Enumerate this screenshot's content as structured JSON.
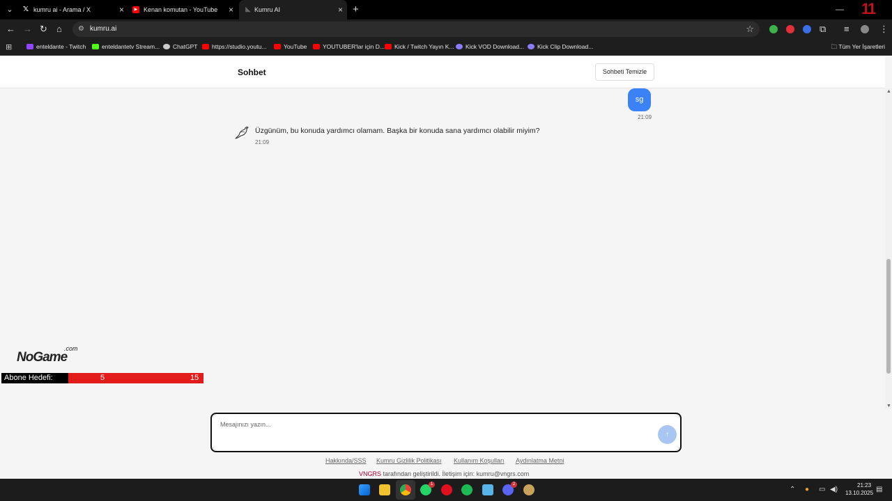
{
  "browser": {
    "tabs": [
      {
        "title": "kumru ai - Arama / X",
        "icon": "x-logo-icon"
      },
      {
        "title": "Kenan komutan - YouTube",
        "icon": "youtube-icon"
      },
      {
        "title": "Kumru AI",
        "icon": "kumru-icon"
      }
    ],
    "url": "kumru.ai",
    "bookmarks": [
      {
        "label": "enteldante - Twitch",
        "color": "#9146ff"
      },
      {
        "label": "enteldantetv Stream...",
        "color": "#53fc18"
      },
      {
        "label": "ChatGPT",
        "color": "#cccccc"
      },
      {
        "label": "https://studio.youtu...",
        "color": "#ff0000"
      },
      {
        "label": "YouTube",
        "color": "#ff0000"
      },
      {
        "label": "YOUTUBER'lar için D...",
        "color": "#ff0000"
      },
      {
        "label": "Kick / Twitch Yayın K...",
        "color": "#ff0000"
      },
      {
        "label": "Kick VOD Download...",
        "color": "#8a7cff"
      },
      {
        "label": "Kick Clip Download...",
        "color": "#8a7cff"
      }
    ],
    "all_bookmarks": "Tüm Yer İşaretleri"
  },
  "page": {
    "title": "Sohbet",
    "clear_button": "Sohbeti Temizle"
  },
  "chat": {
    "user_message": "sg",
    "user_time": "21:09",
    "bot_message": "Üzgünüm, bu konuda yardımcı olamam. Başka bir konuda sana yardımcı olabilir miyim?",
    "bot_time": "21:09"
  },
  "overlay": {
    "logo_text": "NoGame",
    "logo_suffix": ".com",
    "goal_label": "Abone Hedefi:",
    "goal_current": "5",
    "goal_target": "15"
  },
  "composer": {
    "placeholder": "Mesajınızı yazın...",
    "send_icon": "↑"
  },
  "footer": {
    "links": [
      "Hakkında/SSS",
      "Kumru Gizlilik Politikası",
      "Kullanım Koşulları",
      "Aydınlatma Metni"
    ],
    "credit_brand": "VNGRS",
    "credit_text": " tarafından geliştirildi. İletişim için: kumru@vngrs.com"
  },
  "taskbar": {
    "time": "21:23",
    "date": "13.10.2025",
    "badges": {
      "whatsapp": "1",
      "discord": "2"
    }
  },
  "colors": {
    "accent": "#3b82f6",
    "send_disabled": "#a9c6f3",
    "brand_red": "#b3002d",
    "goal_red": "#e21b1b"
  }
}
